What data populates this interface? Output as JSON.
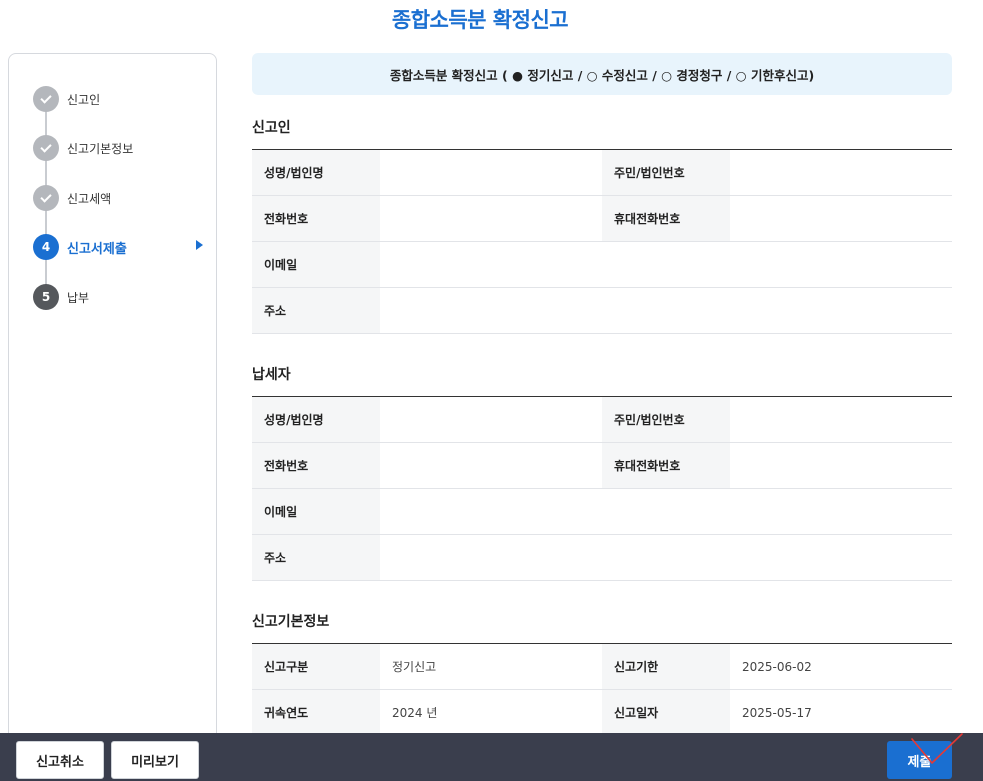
{
  "page_title": "종합소득분 확정신고",
  "steps": [
    {
      "num": "",
      "label": "신고인",
      "state": "done"
    },
    {
      "num": "",
      "label": "신고기본정보",
      "state": "done"
    },
    {
      "num": "",
      "label": "신고세액",
      "state": "done"
    },
    {
      "num": "4",
      "label": "신고서제출",
      "state": "active"
    },
    {
      "num": "5",
      "label": "납부",
      "state": "todo"
    }
  ],
  "notice": "종합소득분 확정신고 ( ● 정기신고 / ○ 수정신고 / ○ 경정청구 / ○ 기한후신고)",
  "sections": {
    "filer": {
      "title": "신고인",
      "name_label": "성명/법인명",
      "id_label": "주민/법인번호",
      "phone_label": "전화번호",
      "mobile_label": "휴대전화번호",
      "email_label": "이메일",
      "address_label": "주소"
    },
    "taxpayer": {
      "title": "납세자",
      "name_label": "성명/법인명",
      "id_label": "주민/법인번호",
      "phone_label": "전화번호",
      "mobile_label": "휴대전화번호",
      "email_label": "이메일",
      "address_label": "주소"
    },
    "basic_info": {
      "title": "신고기본정보",
      "type_label": "신고구분",
      "type_value": "정기신고",
      "deadline_label": "신고기한",
      "deadline_value": "2025-06-02",
      "year_label": "귀속연도",
      "year_value": "2024 년",
      "date_label": "신고일자",
      "date_value": "2025-05-17"
    }
  },
  "buttons": {
    "cancel": "신고취소",
    "preview": "미리보기",
    "submit": "제출"
  },
  "colors": {
    "accent": "#1a6fd1",
    "bottom_bar": "#3a3e4d",
    "notice_bg": "#e8f4fc"
  }
}
